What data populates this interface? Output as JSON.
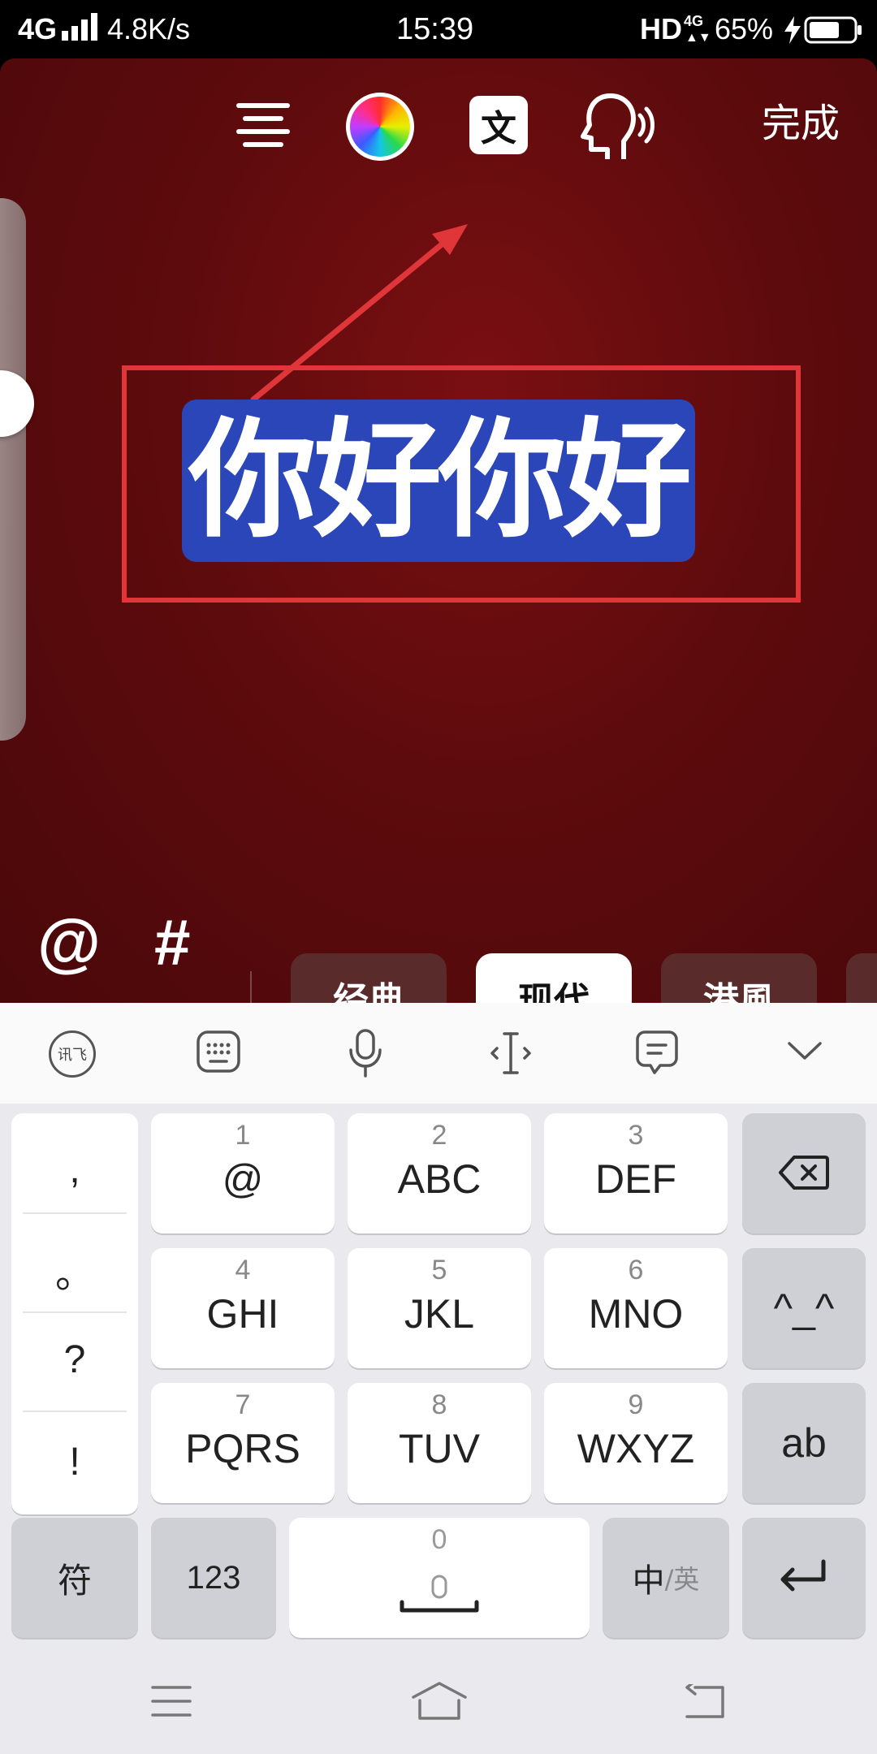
{
  "status_bar": {
    "network": "4G",
    "speed": "4.8K/s",
    "time": "15:39",
    "hd": "HD",
    "net4g": "4G",
    "battery": "65%"
  },
  "editor": {
    "toolbar": {
      "align_icon": "align-center-icon",
      "color_icon": "color-wheel-icon",
      "font_icon_glyph": "文",
      "tts_icon": "speaking-head-icon",
      "done_label": "完成"
    },
    "text_content": "你好你好",
    "chip_color": "#2a46b8",
    "annotation_color": "#e0363a",
    "mention_symbol": "@",
    "hashtag_symbol": "#",
    "styles": [
      {
        "label": "经典",
        "active": false
      },
      {
        "label": "现代",
        "active": true
      },
      {
        "label": "港風",
        "active": false
      }
    ]
  },
  "keyboard": {
    "toolbar": {
      "ime_logo": "讯飞",
      "items": [
        "ime-logo-icon",
        "keyboard-icon",
        "microphone-icon",
        "cursor-icon",
        "clipboard-icon",
        "collapse-chevron-icon"
      ]
    },
    "punctuation": [
      ",",
      "。",
      "?",
      "!"
    ],
    "keys": [
      {
        "num": "1",
        "label": "@"
      },
      {
        "num": "2",
        "label": "ABC"
      },
      {
        "num": "3",
        "label": "DEF"
      },
      {
        "num": "4",
        "label": "GHI"
      },
      {
        "num": "5",
        "label": "JKL"
      },
      {
        "num": "6",
        "label": "MNO"
      },
      {
        "num": "7",
        "label": "PQRS"
      },
      {
        "num": "8",
        "label": "TUV"
      },
      {
        "num": "9",
        "label": "WXYZ"
      }
    ],
    "face_label": "^_^",
    "ab_label": "ab",
    "symbol_label": "符",
    "num_label": "123",
    "space_num": "0",
    "lang_main": "中",
    "lang_alt": "/英"
  }
}
